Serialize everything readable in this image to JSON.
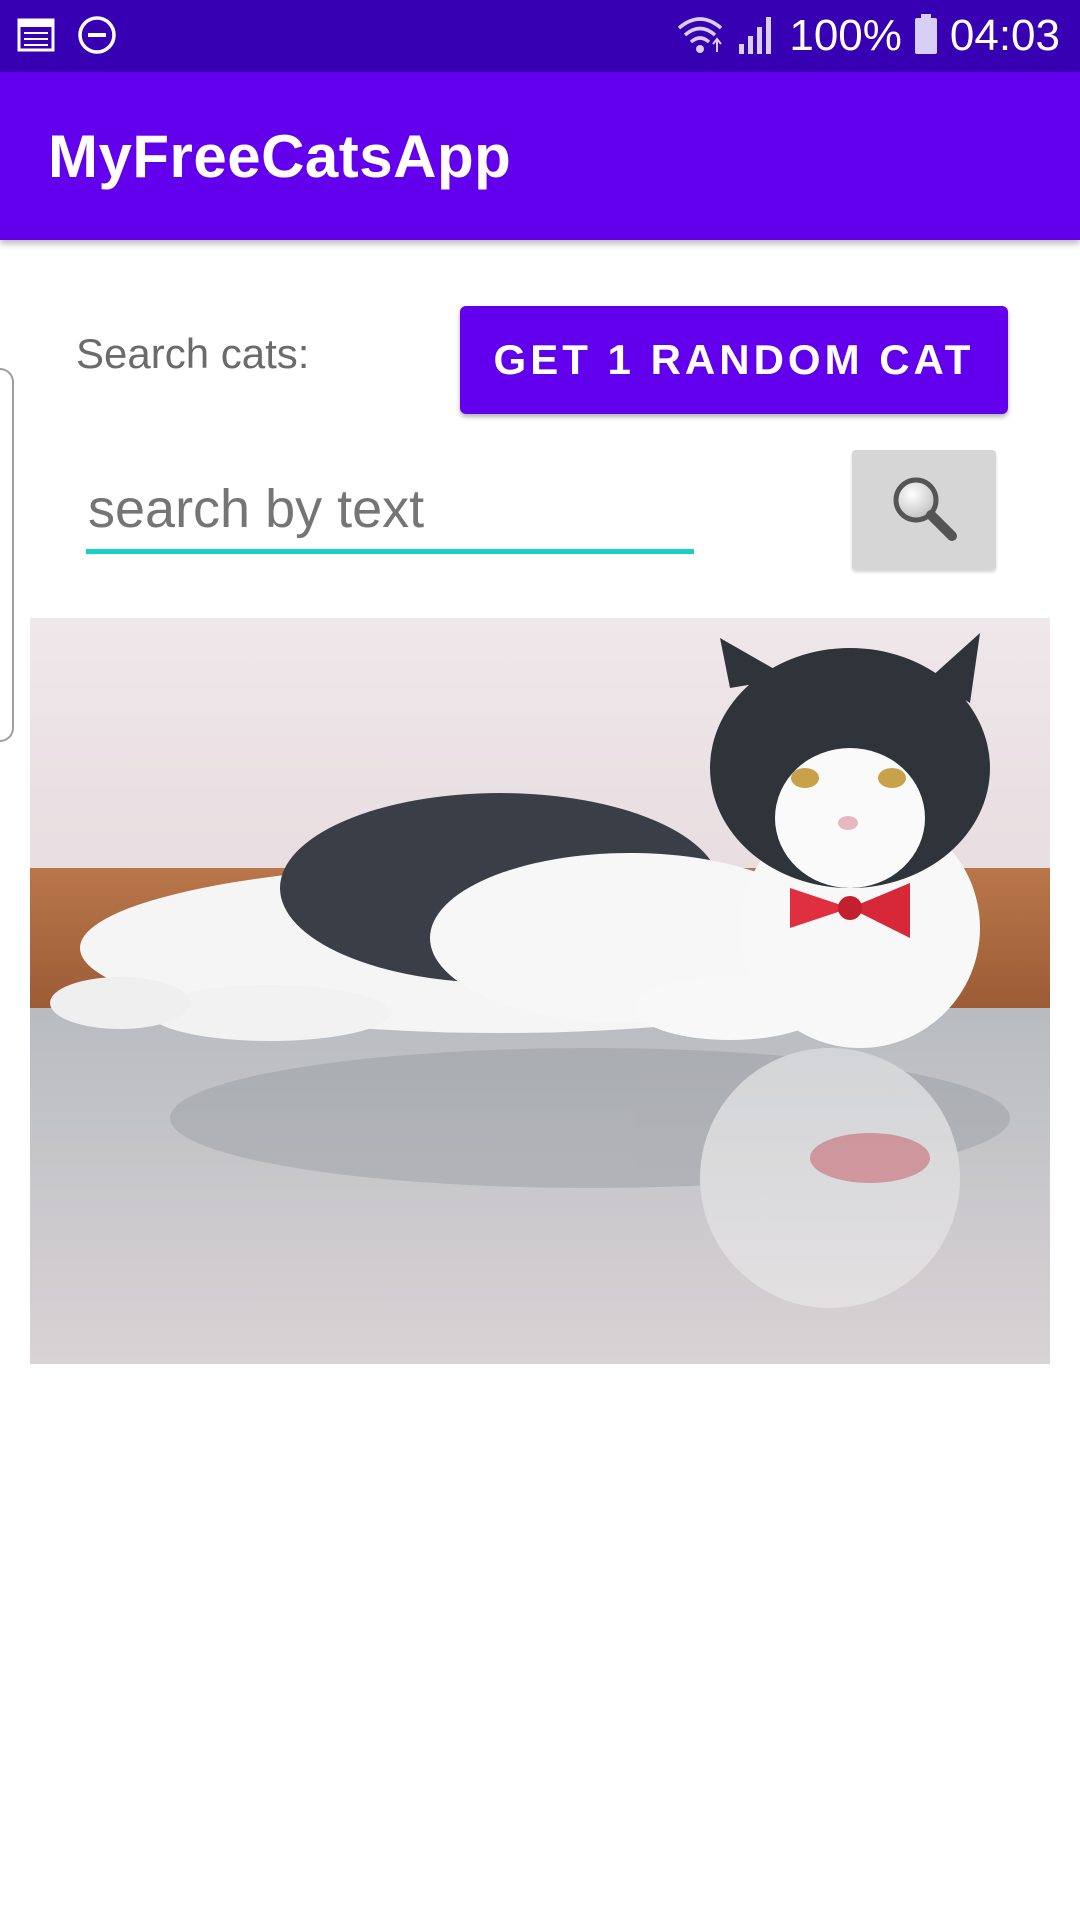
{
  "status_bar": {
    "left_icons": [
      "calendar-icon",
      "do-not-disturb-icon"
    ],
    "right_icons": [
      "wifi-icon",
      "signal-icon",
      "battery-icon"
    ],
    "battery": "100%",
    "time": "04:03",
    "background_color": "#3700B3"
  },
  "app_bar": {
    "title": "MyFreeCatsApp",
    "background_color": "#6200EE"
  },
  "search": {
    "label": "Search cats:",
    "random_button_label": "GET 1 RANDOM CAT",
    "input_value": "",
    "input_placeholder": "search by text",
    "search_button_icon": "magnifier-icon",
    "underline_color": "#18D0C4"
  },
  "result": {
    "image_subject": "cat-photo"
  }
}
